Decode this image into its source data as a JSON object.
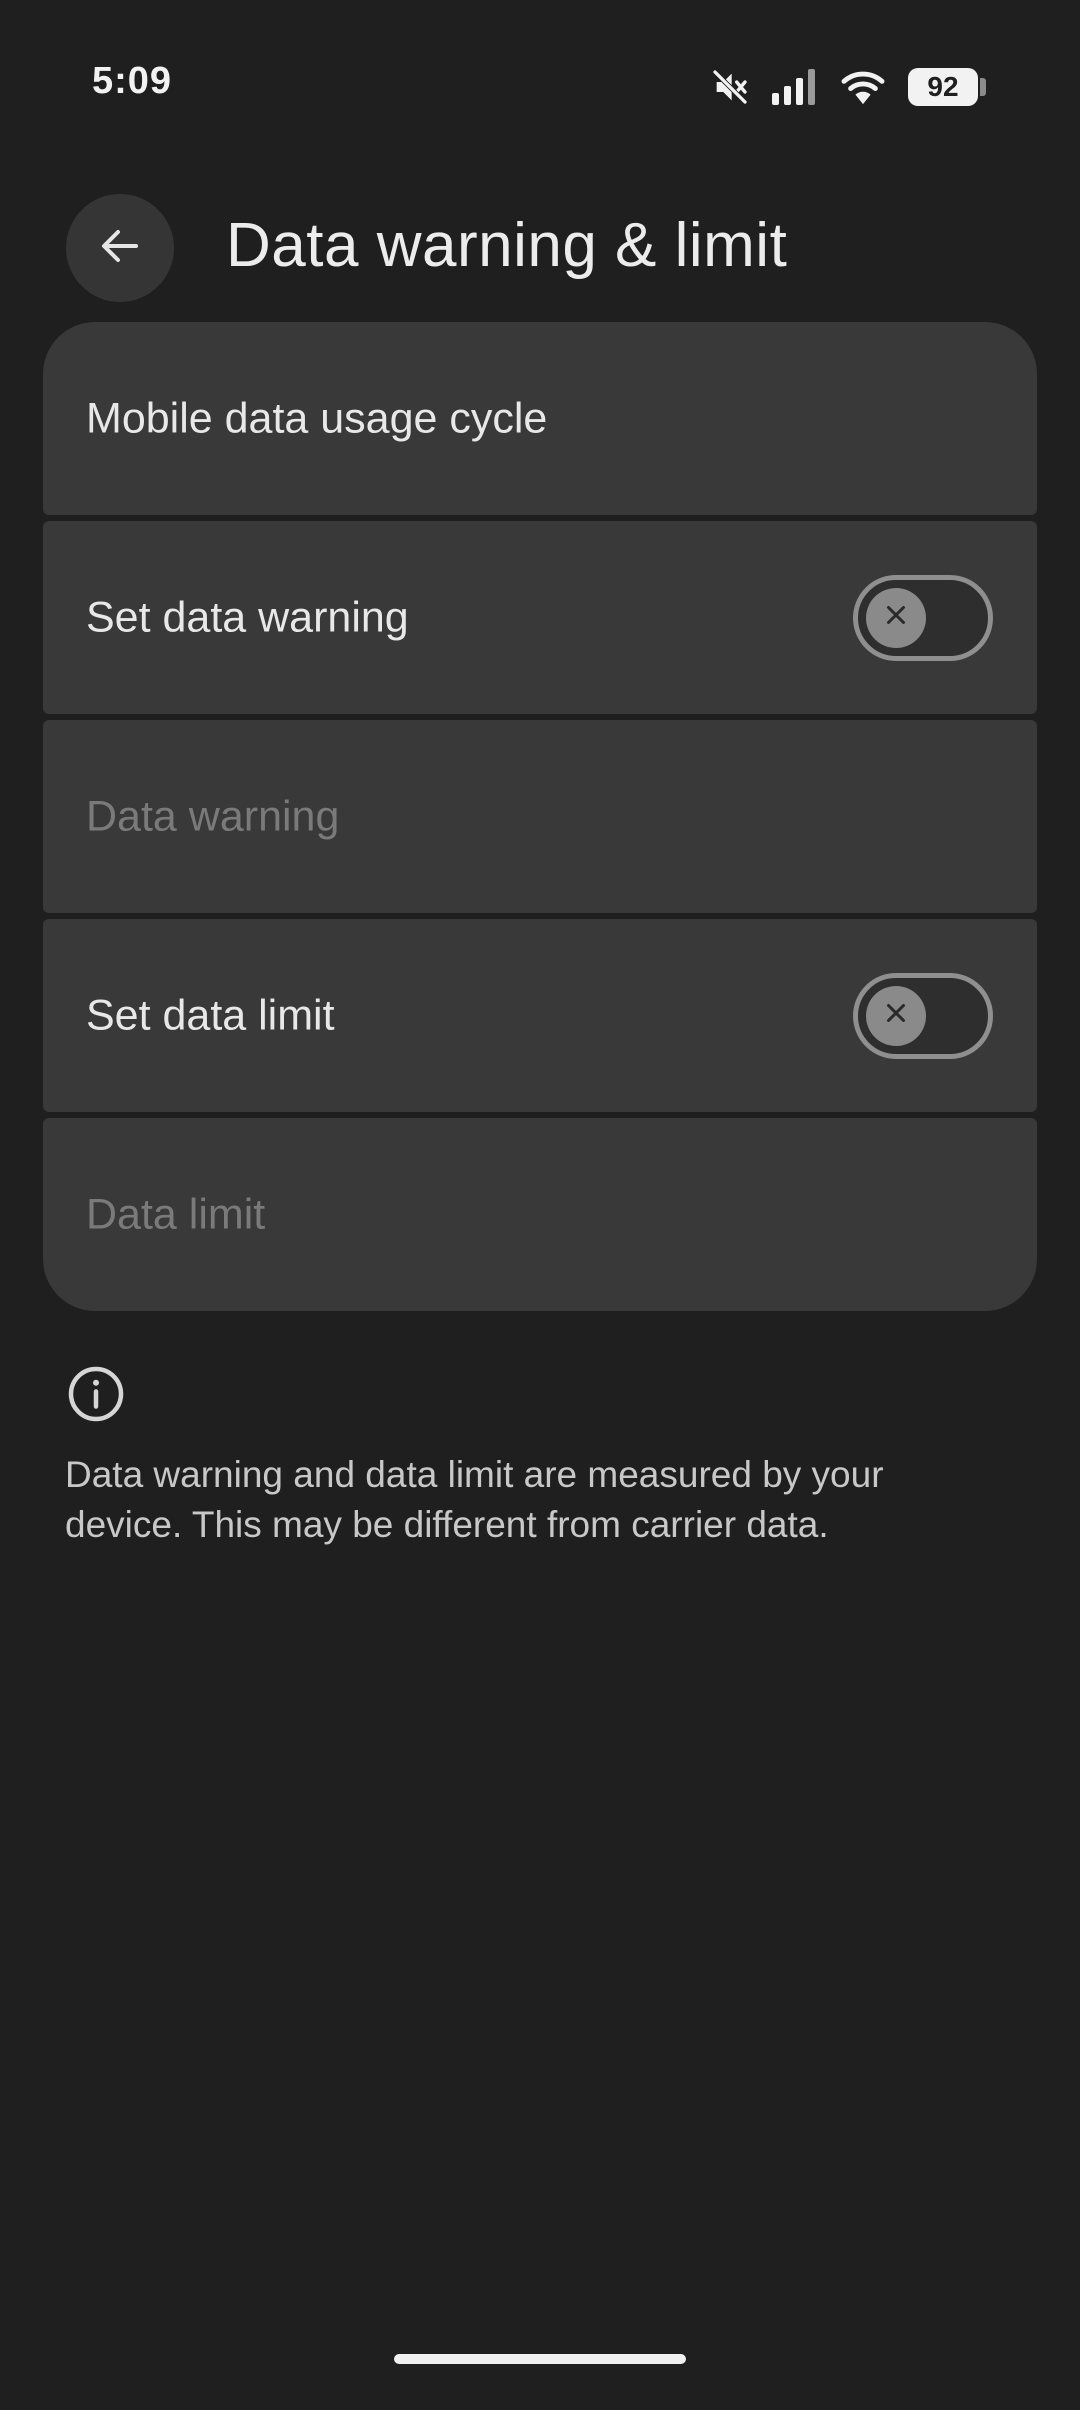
{
  "status_bar": {
    "time": "5:09",
    "battery": "92",
    "icons": [
      "mute-icon",
      "signal-icon",
      "wifi-icon",
      "battery-icon"
    ]
  },
  "header": {
    "title": "Data warning & limit",
    "back_icon": "arrow-back-icon"
  },
  "settings": {
    "rows": [
      {
        "label": "Mobile data usage cycle",
        "enabled": true
      },
      {
        "label": "Set data warning",
        "enabled": true,
        "toggle": false
      },
      {
        "label": "Data warning",
        "enabled": false
      },
      {
        "label": "Set data limit",
        "enabled": true,
        "toggle": false
      },
      {
        "label": "Data limit",
        "enabled": false
      }
    ]
  },
  "info": {
    "icon": "info-icon",
    "text": "Data warning and data limit are measured by your device. This may be different from carrier data."
  },
  "colors": {
    "background": "#1f1f1f",
    "card": "#393939",
    "text": "#e8e8e8",
    "disabled_text": "#7a7a7a"
  }
}
